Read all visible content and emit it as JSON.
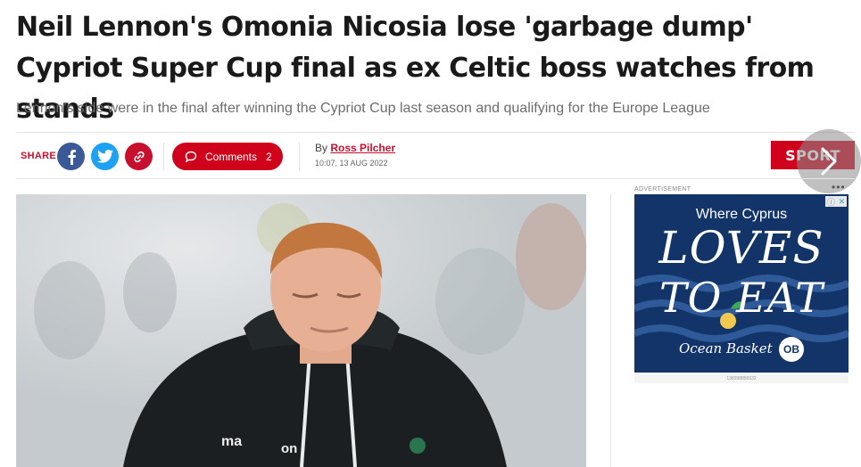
{
  "article": {
    "headline": "Neil Lennon's Omonia Nicosia lose 'garbage dump' Cypriot Super Cup final as ex Celtic boss watches from stands",
    "standfirst": "Lennon's side were in the final after winning the Cypriot Cup last season and qualifying for the Europe League"
  },
  "share": {
    "label": "SHARE",
    "icons": [
      "facebook-icon",
      "twitter-icon",
      "link-icon"
    ]
  },
  "comments": {
    "label": "Comments",
    "count": "2"
  },
  "byline": {
    "prefix": "By",
    "author": "Ross Pilcher",
    "datetime": "10:07, 13 AUG 2022"
  },
  "section": {
    "label": "SPORT"
  },
  "hero_image": {
    "shirt_text_left": "ma",
    "shirt_text_right": "on"
  },
  "advert": {
    "label": "ADVERTISEMENT",
    "menu": "•••",
    "line1": "Where Cyprus",
    "line2": "LOVES",
    "line3": "TO EAT",
    "brand": "Ocean Basket",
    "badge": "OB",
    "id": "138398850632"
  },
  "colors": {
    "brand_red": "#d0021b",
    "facebook": "#3b5998",
    "twitter": "#1da1f2",
    "ad_blue": "#123468"
  }
}
